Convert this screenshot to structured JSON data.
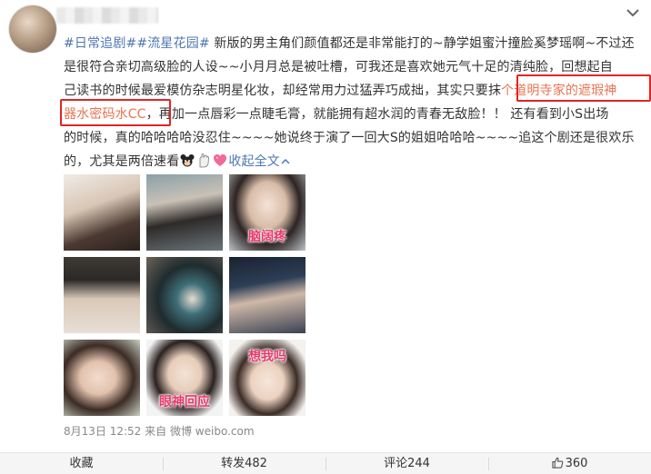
{
  "post": {
    "author_name": "",
    "line1_topic1": "#日常追剧#",
    "line1_topic2": "#流星花园#",
    "line1_rest": " 新版的男主角们颜值都还是非常能打的~静学姐蜜汁撞脸奚梦瑶啊~不过还",
    "line2": "是很符合亲切高级脸的人设~~小月月总是被吐槽，可我还是喜欢她元气十足的清纯脸，回想起自",
    "line3_pre": "己读书的时候最爱模仿杂志明星化妆，却经常用力过猛弄巧成拙，其实只要抹",
    "line3_hl": "个道明寺家的遮瑕神",
    "line4_hl": "器水密码水CC",
    "line4_rest": "，再加一点唇彩一点睫毛膏，就能拥有超水润的青春无敌脸！！ 还有看到小S出场",
    "line5": "的时候，真的哈哈哈哈没忍住~~~~她说终于演了一回大S的姐姐哈哈哈~~~~追这个剧还是很欢乐",
    "line6_pre": "的，尤其是两倍速看",
    "collapse_label": "收起全文",
    "emoji_icons": [
      "mouse-face-emoji-icon",
      "hand-emoji-icon",
      "pink-heart-emoji-icon"
    ]
  },
  "images": [
    {
      "caption": ""
    },
    {
      "caption": ""
    },
    {
      "caption": "脑阔疼"
    },
    {
      "caption": ""
    },
    {
      "caption": ""
    },
    {
      "caption": ""
    },
    {
      "caption": ""
    },
    {
      "caption": "眼神回应"
    },
    {
      "caption": "想我吗"
    }
  ],
  "meta": {
    "timestamp": "8月13日 12:52",
    "source_prefix": "来自",
    "source": "微博 weibo.com"
  },
  "actions": {
    "favorite": "收藏",
    "repost": "转发482",
    "comment": "评论244",
    "like": "360"
  },
  "colors": {
    "topic": "#4f76b2",
    "highlight": "#eb7350",
    "annotation_box": "#e02424",
    "caption": "#e8386a"
  }
}
